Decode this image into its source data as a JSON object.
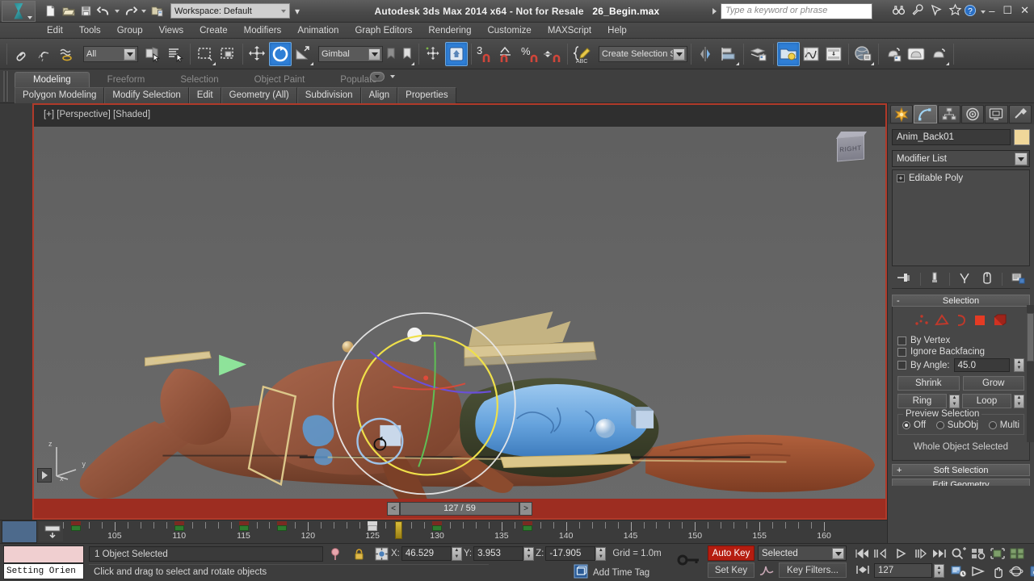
{
  "titlebar": {
    "app_title": "Autodesk 3ds Max  2014 x64  - Not for Resale",
    "file_name": "26_Begin.max",
    "workspace": "Workspace: Default",
    "search_placeholder": "Type a keyword or phrase",
    "minimize": "–",
    "maximize": "☐",
    "close": "✕",
    "icons": [
      "new-file-icon",
      "open-file-icon",
      "save-file-icon",
      "undo-icon",
      "redo-icon",
      "set-project-folder-icon",
      "search-binoculars-icon",
      "wrench-icon",
      "communication-icon",
      "favorites-star-icon",
      "help-icon"
    ]
  },
  "menu": {
    "items": [
      "Edit",
      "Tools",
      "Group",
      "Views",
      "Create",
      "Modifiers",
      "Animation",
      "Graph Editors",
      "Rendering",
      "Customize",
      "MAXScript",
      "Help"
    ]
  },
  "toolbar": {
    "selection_filter": "All",
    "reference_coord": "Gimbal",
    "named_selection_sets": "Create Selection Se",
    "angle_snap_number": "3",
    "icons": [
      "select-link-icon",
      "unlink-icon",
      "bind-space-warp-icon",
      "select-object-icon",
      "select-by-name-icon",
      "rectangular-selection-region-icon",
      "window-crossing-icon",
      "select-and-move-icon",
      "select-and-rotate-icon",
      "select-and-scale-icon",
      "use-pivot-center-icon",
      "use-selection-center-icon",
      "snaps-toggle-icon",
      "angle-snap-icon",
      "percent-snap-icon",
      "spinner-snap-icon",
      "edit-named-selection-sets-icon",
      "mirror-icon",
      "align-icon",
      "layer-manager-icon",
      "graph-editor-icon",
      "scene-explorer-icon",
      "material-editor-icon",
      "curve-editor-icon",
      "schematic-view-icon",
      "render-setup-icon",
      "rendered-frame-window-icon",
      "render-production-icon",
      "render-iterative-icon"
    ]
  },
  "ribbon": {
    "tabs": [
      {
        "label": "Modeling",
        "selected": true
      },
      {
        "label": "Freeform",
        "selected": false
      },
      {
        "label": "Selection",
        "selected": false
      },
      {
        "label": "Object Paint",
        "selected": false
      },
      {
        "label": "Populate",
        "selected": false
      }
    ],
    "panels": [
      "Polygon Modeling",
      "Modify Selection",
      "Edit",
      "Geometry (All)",
      "Subdivision",
      "Align",
      "Properties"
    ]
  },
  "viewport": {
    "label": "[+] [Perspective] [Shaded]",
    "viewcube_face": "RIGHT",
    "axis_labels": {
      "x": "x",
      "y": "y",
      "z": "z"
    },
    "time_display": "127 / 59",
    "time_prev": "<",
    "time_next": ">"
  },
  "trackbar": {
    "ticks_start": 101,
    "ticks_end": 161,
    "labels": [
      105,
      110,
      115,
      120,
      125,
      130,
      135,
      140,
      145,
      150,
      155,
      160
    ],
    "keys": [
      102,
      110,
      115,
      118,
      130,
      137
    ],
    "white_keys": [
      125
    ],
    "playhead_frame": 127
  },
  "command_panel": {
    "tabs": [
      "create-tab",
      "modify-tab",
      "hierarchy-tab",
      "motion-tab",
      "display-tab",
      "utilities-tab"
    ],
    "selected_tab_index": 1,
    "object_name": "Anim_Back01",
    "object_color": "#f0d79a",
    "modifier_list": "Modifier List",
    "stack_items": [
      "Editable Poly"
    ],
    "stack_buttons": [
      "pin-stack-icon",
      "show-end-result-icon",
      "make-unique-icon",
      "remove-modifier-icon",
      "configure-modifier-sets-icon"
    ],
    "selection_rollout": {
      "title": "Selection",
      "collapse": "-",
      "sub_object_levels": [
        "vertex-icon",
        "edge-icon",
        "border-icon",
        "polygon-icon",
        "element-icon"
      ],
      "by_vertex": "By Vertex",
      "ignore_backfacing": "Ignore Backfacing",
      "by_angle": "By Angle:",
      "by_angle_value": "45.0",
      "shrink": "Shrink",
      "grow": "Grow",
      "ring": "Ring",
      "loop": "Loop",
      "preview_selection_label": "Preview Selection",
      "preview_options": [
        {
          "label": "Off",
          "selected": true
        },
        {
          "label": "SubObj",
          "selected": false
        },
        {
          "label": "Multi",
          "selected": false
        }
      ],
      "status": "Whole Object Selected"
    },
    "soft_selection": {
      "title": "Soft Selection",
      "expand": "+"
    },
    "edit_geometry": {
      "title": "Edit Geometry"
    }
  },
  "statusbar": {
    "maxscript_mini_listener": "Setting Orien",
    "selection_status": "1 Object Selected",
    "prompt": "Click and drag to select and rotate objects",
    "coords": [
      {
        "label": "X:",
        "value": "46.529"
      },
      {
        "label": "Y:",
        "value": "3.953"
      },
      {
        "label": "Z:",
        "value": "-17.905"
      }
    ],
    "grid": "Grid = 1.0m",
    "add_time_tag": "Add Time Tag",
    "auto_key": "Auto Key",
    "set_key": "Set Key",
    "key_mode": "Selected",
    "key_filters": "Key Filters...",
    "current_frame": "127",
    "icons": [
      "selection-lock-icon",
      "absolute-relative-transform-icon",
      "key-mode-toggle-icon",
      "goto-start-icon",
      "previous-frame-icon",
      "play-animation-icon",
      "next-frame-icon",
      "goto-end-icon",
      "zoom-icon",
      "zoom-all-icon",
      "zoom-extents-icon",
      "zoom-extents-all-icon",
      "key-mode-icon",
      "time-configuration-icon",
      "field-of-view-icon",
      "pan-view-icon",
      "orbit-icon",
      "maximize-viewport-icon"
    ]
  },
  "colors": {
    "accent_red": "#b51d10",
    "viewport_border": "#b03a2a",
    "timeline_red": "#9d2d21",
    "highlight_blue": "#2f7fd6",
    "object_yellow": "#f0d79a",
    "gizmo_yellow": "#e8d24a",
    "panel_bg": "#444444",
    "creature_skin": "#8f5442",
    "creature_blue": "#6aa7e0"
  }
}
